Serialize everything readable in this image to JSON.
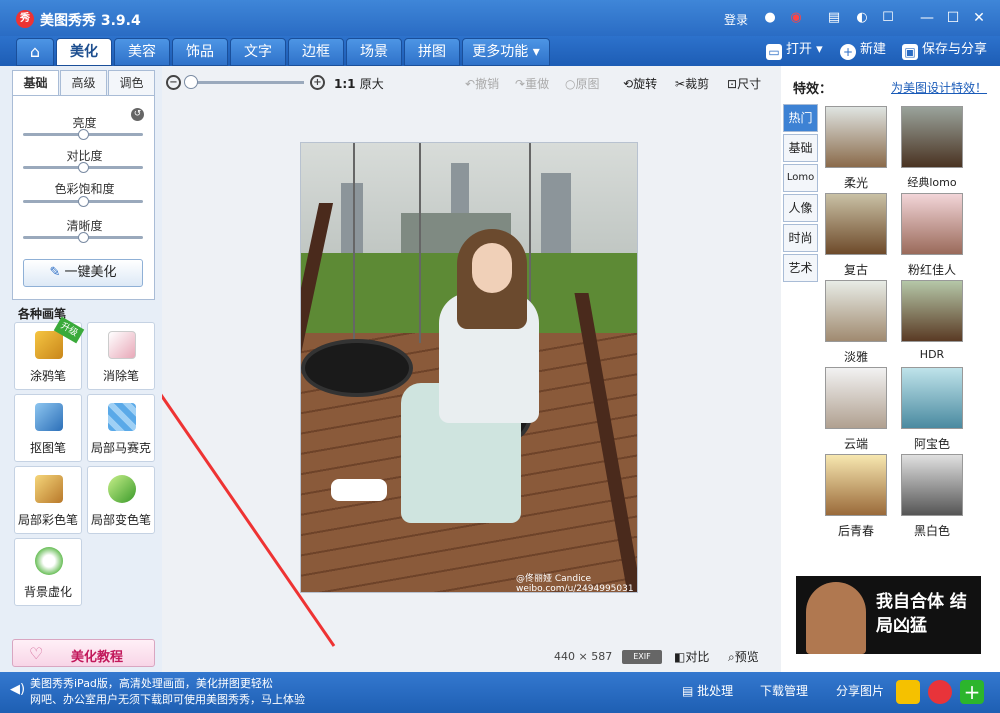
{
  "app": {
    "title": "美图秀秀 3.9.4",
    "icon": "meitu-logo-icon",
    "login": "登录"
  },
  "nav": {
    "tabs": [
      "美化",
      "美容",
      "饰品",
      "文字",
      "边框",
      "场景",
      "拼图",
      "更多功能"
    ],
    "active_tab": "美化",
    "open": "打开",
    "new": "新建",
    "save_share": "保存与分享"
  },
  "left": {
    "subtabs": [
      "基础",
      "高级",
      "调色"
    ],
    "active_subtab": "基础",
    "adjustments": [
      {
        "label": "亮度",
        "level": 0.5
      },
      {
        "label": "对比度",
        "level": 0.5
      },
      {
        "label": "色彩饱和度",
        "level": 0.5
      },
      {
        "label": "清晰度",
        "level": 0.5
      }
    ],
    "one_click": "一键美化",
    "pens_title": "各种画笔",
    "upgrade_badge": "升级",
    "pens": [
      "涂鸦笔",
      "消除笔",
      "抠图笔",
      "局部马赛克",
      "局部彩色笔",
      "局部变色笔",
      "背景虚化"
    ],
    "tutorial": "美化教程"
  },
  "toolbar": {
    "ratio": "1:1",
    "original_size": "原大",
    "undo": "撤销",
    "redo": "重做",
    "original": "原图",
    "rotate": "旋转",
    "crop": "裁剪",
    "resize": "尺寸"
  },
  "canvas": {
    "watermark_line1": "@佟丽娅 Candice",
    "watermark_line2": "weibo.com/u/2494995031",
    "width": "440",
    "times": "×",
    "height": "587",
    "exif": "EXIF",
    "compare": "对比",
    "preview": "预览"
  },
  "right": {
    "title": "特效：",
    "link": "为美图设计特效！",
    "categories": [
      "热门",
      "基础",
      "Lomo",
      "人像",
      "时尚",
      "艺术"
    ],
    "active_category": "热门",
    "effects": [
      "柔光",
      "经典lomo",
      "复古",
      "粉红佳人",
      "淡雅",
      "HDR",
      "云端",
      "阿宝色",
      "后青春",
      "黑白色"
    ],
    "ad_text": "我自合体 结局凶猛"
  },
  "status": {
    "message_line1": "美图秀秀iPad版，高清处理画面，美化拼图更轻松",
    "message_line2": "网吧、办公室用户无须下载即可使用美图秀秀，马上体验",
    "batch": "批处理",
    "download_manager": "下载管理",
    "share_photo": "分享图片"
  },
  "colors": {
    "accent": "#2a6cc4",
    "active_tab_text": "#1d4e8f",
    "link": "#1a5bb8"
  }
}
